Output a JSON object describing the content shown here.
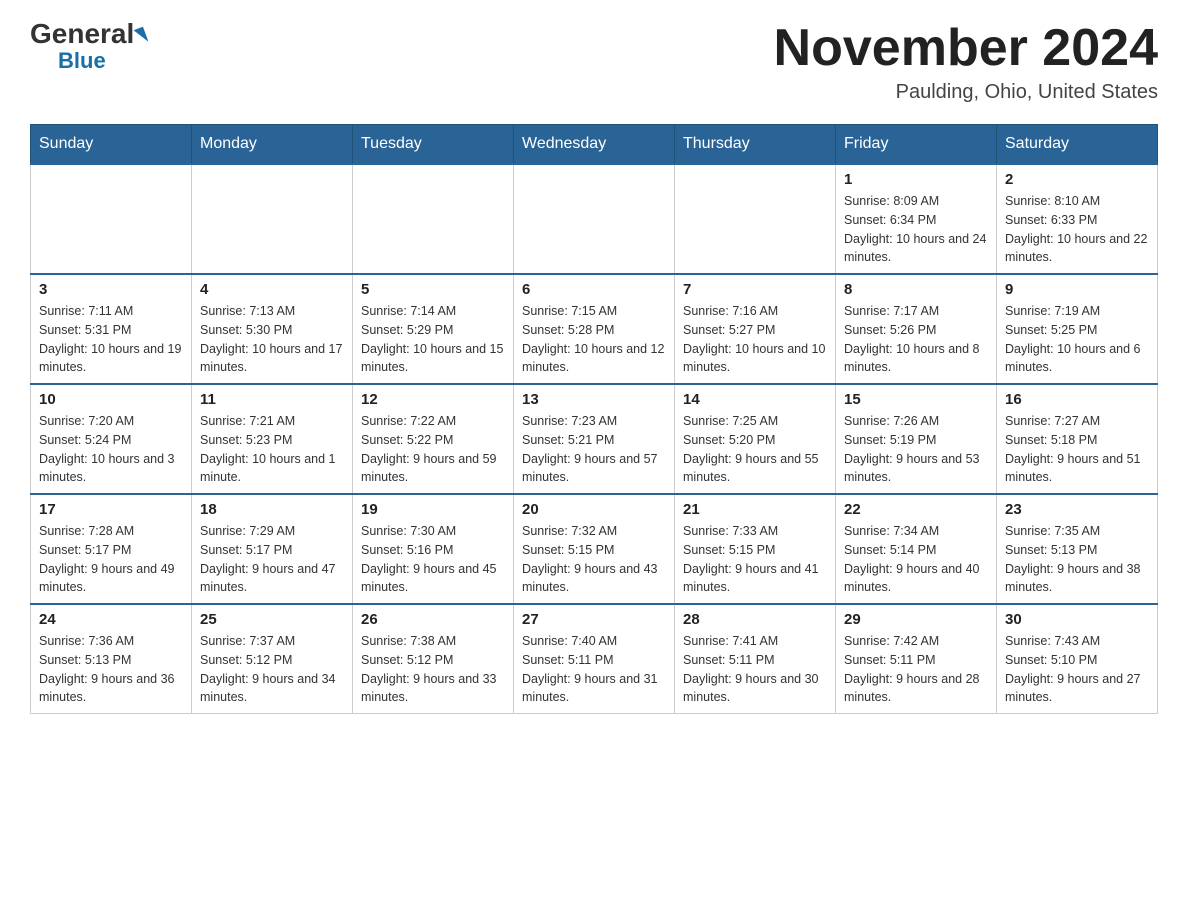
{
  "logo": {
    "general": "General",
    "blue": "Blue"
  },
  "title": "November 2024",
  "location": "Paulding, Ohio, United States",
  "days_of_week": [
    "Sunday",
    "Monday",
    "Tuesday",
    "Wednesday",
    "Thursday",
    "Friday",
    "Saturday"
  ],
  "weeks": [
    [
      {
        "day": "",
        "info": ""
      },
      {
        "day": "",
        "info": ""
      },
      {
        "day": "",
        "info": ""
      },
      {
        "day": "",
        "info": ""
      },
      {
        "day": "",
        "info": ""
      },
      {
        "day": "1",
        "info": "Sunrise: 8:09 AM\nSunset: 6:34 PM\nDaylight: 10 hours and 24 minutes."
      },
      {
        "day": "2",
        "info": "Sunrise: 8:10 AM\nSunset: 6:33 PM\nDaylight: 10 hours and 22 minutes."
      }
    ],
    [
      {
        "day": "3",
        "info": "Sunrise: 7:11 AM\nSunset: 5:31 PM\nDaylight: 10 hours and 19 minutes."
      },
      {
        "day": "4",
        "info": "Sunrise: 7:13 AM\nSunset: 5:30 PM\nDaylight: 10 hours and 17 minutes."
      },
      {
        "day": "5",
        "info": "Sunrise: 7:14 AM\nSunset: 5:29 PM\nDaylight: 10 hours and 15 minutes."
      },
      {
        "day": "6",
        "info": "Sunrise: 7:15 AM\nSunset: 5:28 PM\nDaylight: 10 hours and 12 minutes."
      },
      {
        "day": "7",
        "info": "Sunrise: 7:16 AM\nSunset: 5:27 PM\nDaylight: 10 hours and 10 minutes."
      },
      {
        "day": "8",
        "info": "Sunrise: 7:17 AM\nSunset: 5:26 PM\nDaylight: 10 hours and 8 minutes."
      },
      {
        "day": "9",
        "info": "Sunrise: 7:19 AM\nSunset: 5:25 PM\nDaylight: 10 hours and 6 minutes."
      }
    ],
    [
      {
        "day": "10",
        "info": "Sunrise: 7:20 AM\nSunset: 5:24 PM\nDaylight: 10 hours and 3 minutes."
      },
      {
        "day": "11",
        "info": "Sunrise: 7:21 AM\nSunset: 5:23 PM\nDaylight: 10 hours and 1 minute."
      },
      {
        "day": "12",
        "info": "Sunrise: 7:22 AM\nSunset: 5:22 PM\nDaylight: 9 hours and 59 minutes."
      },
      {
        "day": "13",
        "info": "Sunrise: 7:23 AM\nSunset: 5:21 PM\nDaylight: 9 hours and 57 minutes."
      },
      {
        "day": "14",
        "info": "Sunrise: 7:25 AM\nSunset: 5:20 PM\nDaylight: 9 hours and 55 minutes."
      },
      {
        "day": "15",
        "info": "Sunrise: 7:26 AM\nSunset: 5:19 PM\nDaylight: 9 hours and 53 minutes."
      },
      {
        "day": "16",
        "info": "Sunrise: 7:27 AM\nSunset: 5:18 PM\nDaylight: 9 hours and 51 minutes."
      }
    ],
    [
      {
        "day": "17",
        "info": "Sunrise: 7:28 AM\nSunset: 5:17 PM\nDaylight: 9 hours and 49 minutes."
      },
      {
        "day": "18",
        "info": "Sunrise: 7:29 AM\nSunset: 5:17 PM\nDaylight: 9 hours and 47 minutes."
      },
      {
        "day": "19",
        "info": "Sunrise: 7:30 AM\nSunset: 5:16 PM\nDaylight: 9 hours and 45 minutes."
      },
      {
        "day": "20",
        "info": "Sunrise: 7:32 AM\nSunset: 5:15 PM\nDaylight: 9 hours and 43 minutes."
      },
      {
        "day": "21",
        "info": "Sunrise: 7:33 AM\nSunset: 5:15 PM\nDaylight: 9 hours and 41 minutes."
      },
      {
        "day": "22",
        "info": "Sunrise: 7:34 AM\nSunset: 5:14 PM\nDaylight: 9 hours and 40 minutes."
      },
      {
        "day": "23",
        "info": "Sunrise: 7:35 AM\nSunset: 5:13 PM\nDaylight: 9 hours and 38 minutes."
      }
    ],
    [
      {
        "day": "24",
        "info": "Sunrise: 7:36 AM\nSunset: 5:13 PM\nDaylight: 9 hours and 36 minutes."
      },
      {
        "day": "25",
        "info": "Sunrise: 7:37 AM\nSunset: 5:12 PM\nDaylight: 9 hours and 34 minutes."
      },
      {
        "day": "26",
        "info": "Sunrise: 7:38 AM\nSunset: 5:12 PM\nDaylight: 9 hours and 33 minutes."
      },
      {
        "day": "27",
        "info": "Sunrise: 7:40 AM\nSunset: 5:11 PM\nDaylight: 9 hours and 31 minutes."
      },
      {
        "day": "28",
        "info": "Sunrise: 7:41 AM\nSunset: 5:11 PM\nDaylight: 9 hours and 30 minutes."
      },
      {
        "day": "29",
        "info": "Sunrise: 7:42 AM\nSunset: 5:11 PM\nDaylight: 9 hours and 28 minutes."
      },
      {
        "day": "30",
        "info": "Sunrise: 7:43 AM\nSunset: 5:10 PM\nDaylight: 9 hours and 27 minutes."
      }
    ]
  ]
}
